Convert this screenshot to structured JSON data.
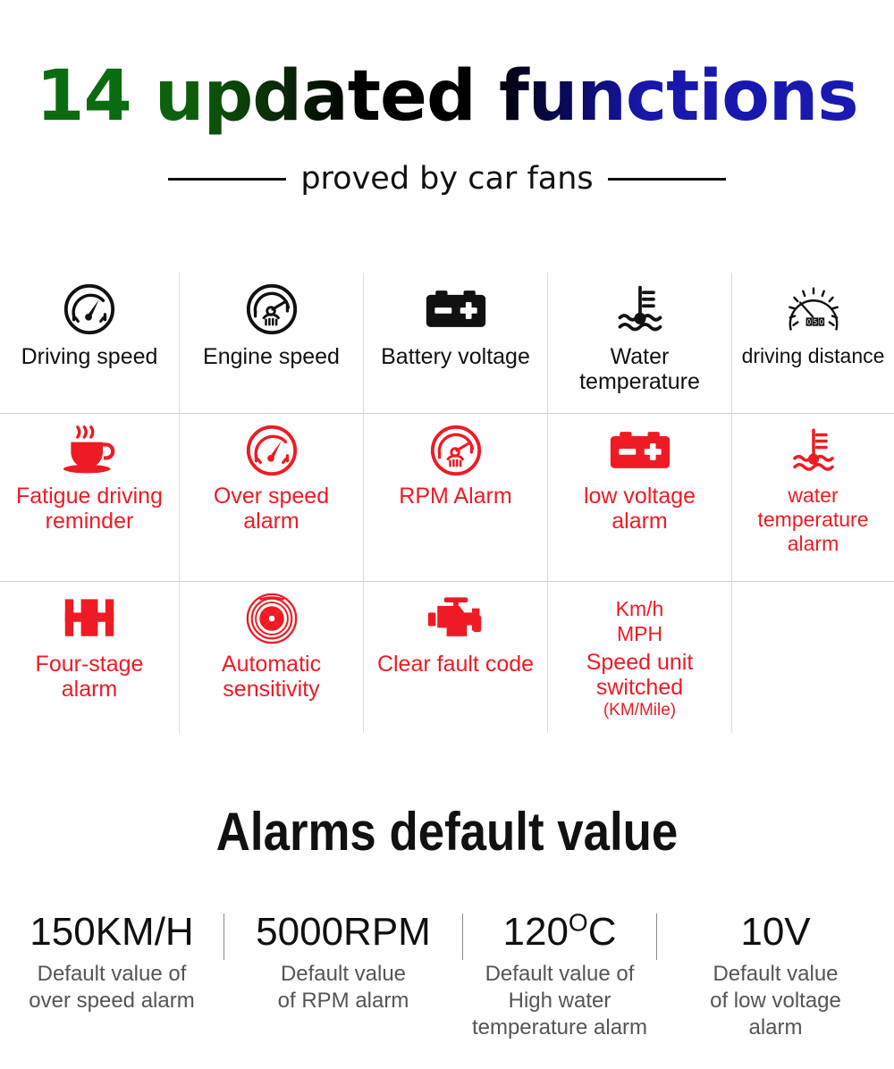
{
  "header": {
    "title": "14 updated functions",
    "title_gradient": [
      "#0a6b10",
      "#000000",
      "#1a1ab4"
    ],
    "subtitle": "proved by car fans"
  },
  "palette": {
    "red": "#ee1b24",
    "black": "#111111",
    "gray_text": "#555555",
    "grid_line": "#dcdcdc"
  },
  "features": {
    "rows": [
      {
        "cells": [
          {
            "icon": "speedometer-icon",
            "label": "Driving speed",
            "color": "#111111"
          },
          {
            "icon": "tachometer-icon",
            "label": "Engine speed",
            "color": "#111111"
          },
          {
            "icon": "battery-icon",
            "label": "Battery voltage",
            "color": "#111111"
          },
          {
            "icon": "water-temperature-icon",
            "label": "Water\ntemperature",
            "color": "#111111"
          },
          {
            "icon": "odometer-icon",
            "label": "driving distance",
            "color": "#111111"
          }
        ]
      },
      {
        "cells": [
          {
            "icon": "coffee-cup-icon",
            "label": "Fatigue driving\nreminder",
            "color": "#ee1b24"
          },
          {
            "icon": "speedometer-icon",
            "label": "Over speed\nalarm",
            "color": "#ee1b24"
          },
          {
            "icon": "tachometer-icon",
            "label": "RPM Alarm",
            "color": "#ee1b24"
          },
          {
            "icon": "battery-icon",
            "label": "low voltage\nalarm",
            "color": "#ee1b24"
          },
          {
            "icon": "water-temperature-icon",
            "label": "water\ntemperature alarm",
            "color": "#ee1b24"
          }
        ]
      },
      {
        "cells": [
          {
            "icon": "four-stage-icon",
            "label": "Four-stage\nalarm",
            "color": "#ee1b24"
          },
          {
            "icon": "turbine-icon",
            "label": "Automatic\nsensitivity",
            "color": "#ee1b24"
          },
          {
            "icon": "engine-icon",
            "label": "Clear fault code",
            "color": "#ee1b24"
          },
          {
            "icon": "none",
            "label": "Speed unit\nswitched",
            "color": "#ee1b24",
            "unit_top": "Km/h",
            "unit_top2": "MPH",
            "note": "(KM/Mile)"
          },
          {
            "icon": "none",
            "label": "",
            "color": "#ee1b24"
          }
        ]
      }
    ]
  },
  "defaults": {
    "title": "Alarms default value",
    "items": [
      {
        "value": "150KM/H",
        "desc": "Default value of\nover speed alarm"
      },
      {
        "value": "5000RPM",
        "desc": "Default value\nof RPM alarm"
      },
      {
        "value": "120",
        "sup": "O",
        "value_suffix": "C",
        "desc": "Default value of\nHigh water\ntemperature alarm"
      },
      {
        "value": "10V",
        "desc": "Default value\nof low voltage\nalarm"
      }
    ]
  }
}
